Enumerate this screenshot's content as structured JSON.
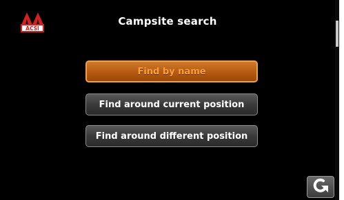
{
  "header": {
    "title": "Campsite search",
    "logo_text": "ACSI",
    "logo_icon": "acsi-tents-logo"
  },
  "menu": {
    "items": [
      {
        "label": "Find by name",
        "state": "selected"
      },
      {
        "label": "Find around current position",
        "state": "normal"
      },
      {
        "label": "Find around different position",
        "state": "normal"
      }
    ]
  },
  "footer": {
    "back_icon": "back-arrow-icon"
  },
  "colors": {
    "background": "#000000",
    "accent": "#ff9e3a",
    "logo_red": "#d42020"
  }
}
